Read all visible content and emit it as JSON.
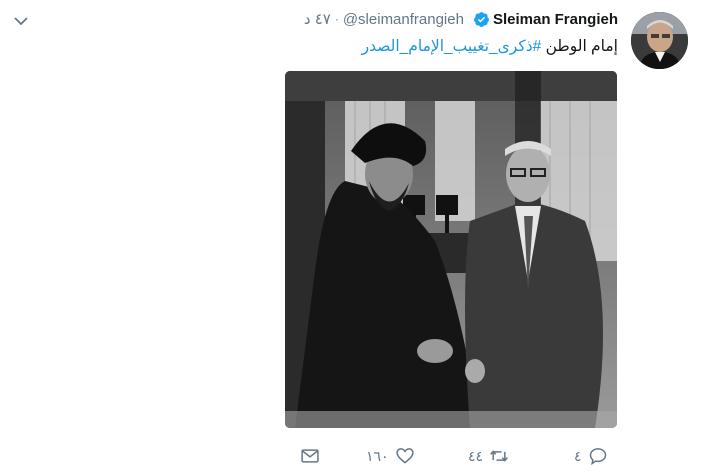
{
  "author": {
    "display_name": "Sleiman Frangieh",
    "handle": "@sleimanfrangieh",
    "separator": "·",
    "timestamp": "٤٧ د",
    "verified": true
  },
  "tweet": {
    "text_plain": "إمام الوطن",
    "hashtag": "#ذكرى_تغييب_الإمام_الصدر"
  },
  "actions": {
    "reply_count": "٤",
    "retweet_count": "٤٤",
    "like_count": "١٦٠"
  },
  "icons": {
    "caret": "chevron-down-icon",
    "verified": "verified-badge-icon",
    "reply": "reply-icon",
    "retweet": "retweet-icon",
    "like": "heart-icon",
    "dm": "envelope-icon"
  },
  "colors": {
    "link": "#1b95e0",
    "muted": "#657786",
    "text": "#14171a",
    "verified": "#1da1f2"
  }
}
